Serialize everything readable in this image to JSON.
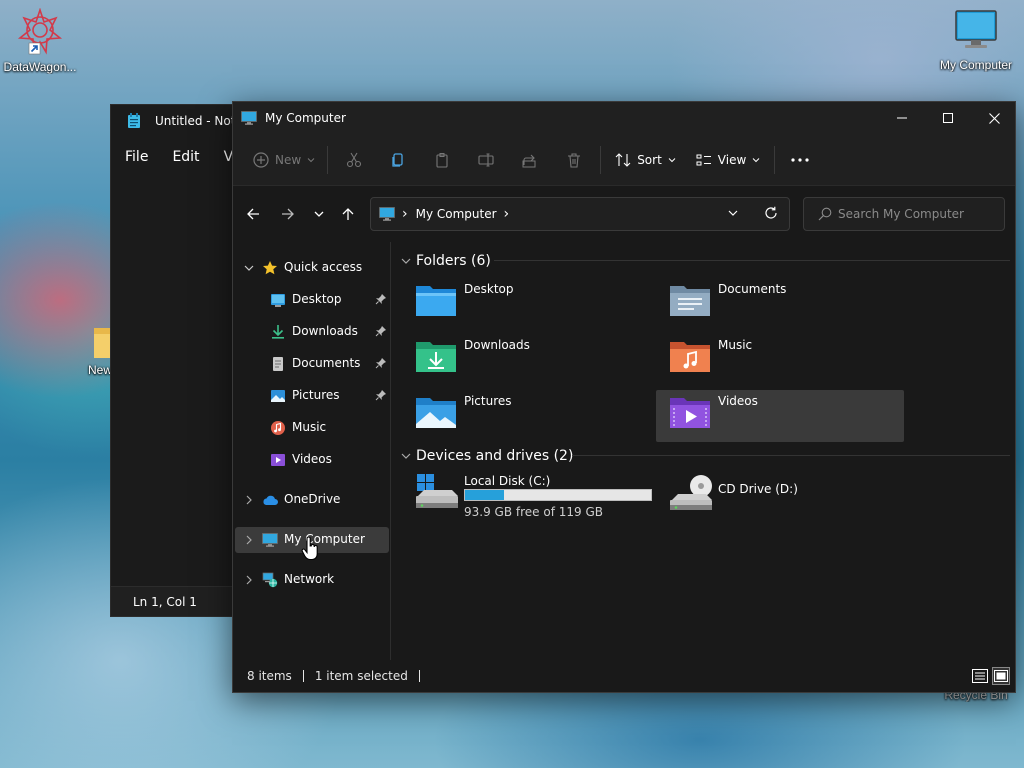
{
  "desktop": {
    "icons": [
      {
        "label": "DataWagon..."
      },
      {
        "label": "My Computer"
      },
      {
        "label": "New"
      },
      {
        "label": "Recycle Bin"
      }
    ]
  },
  "notepad": {
    "title": "Untitled - Not",
    "menu": [
      "File",
      "Edit",
      "V"
    ],
    "status": "Ln 1, Col 1"
  },
  "explorer": {
    "title": "My Computer",
    "commands": {
      "new_label": "New",
      "sort_label": "Sort",
      "view_label": "View"
    },
    "address": {
      "path": "My Computer",
      "separator": "›"
    },
    "search": {
      "placeholder": "Search My Computer"
    },
    "nav": {
      "quick_access": "Quick access",
      "items": [
        {
          "label": "Desktop",
          "pinned": true
        },
        {
          "label": "Downloads",
          "pinned": true
        },
        {
          "label": "Documents",
          "pinned": true
        },
        {
          "label": "Pictures",
          "pinned": true
        },
        {
          "label": "Music",
          "pinned": false
        },
        {
          "label": "Videos",
          "pinned": false
        }
      ],
      "onedrive": "OneDrive",
      "my_computer": "My Computer",
      "network": "Network"
    },
    "folders_header": "Folders (6)",
    "folders": [
      {
        "name": "Desktop"
      },
      {
        "name": "Documents"
      },
      {
        "name": "Downloads"
      },
      {
        "name": "Music"
      },
      {
        "name": "Pictures"
      },
      {
        "name": "Videos",
        "selected": true
      }
    ],
    "drives_header": "Devices and drives (2)",
    "drives": [
      {
        "name": "Local Disk (C:)",
        "free": "93.9 GB free of 119 GB",
        "used_fraction": 0.21
      },
      {
        "name": "CD Drive (D:)"
      }
    ],
    "status": {
      "items": "8 items",
      "selected": "1 item selected"
    }
  },
  "colors": {
    "accent": "#26a0da",
    "window_bg": "#191919",
    "chrome_bg": "#202020",
    "selection": "#3b3b3b"
  }
}
